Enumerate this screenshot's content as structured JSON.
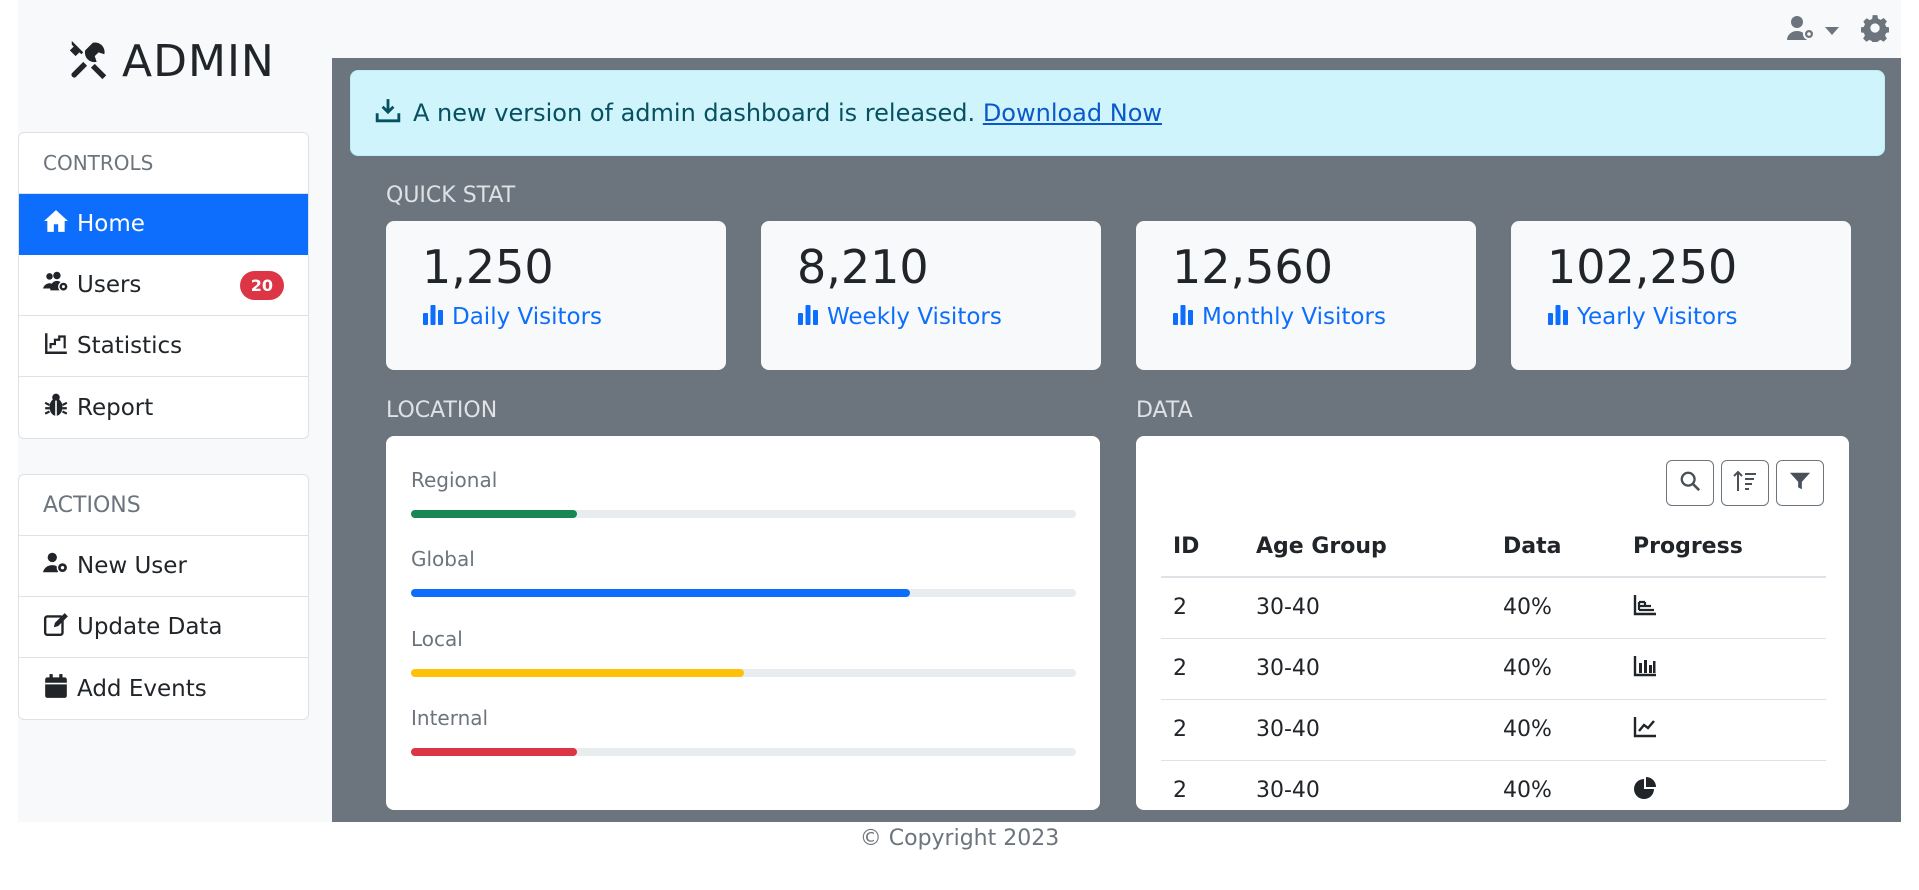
{
  "brand": {
    "name": "ADMIN"
  },
  "controls": {
    "heading": "CONTROLS",
    "items": [
      {
        "label": "Home"
      },
      {
        "label": "Users",
        "badge": "20"
      },
      {
        "label": "Statistics"
      },
      {
        "label": "Report"
      }
    ]
  },
  "actions": {
    "heading": "ACTIONS",
    "items": [
      {
        "label": "New User"
      },
      {
        "label": "Update Data"
      },
      {
        "label": "Add Events"
      }
    ]
  },
  "alert": {
    "text": "A new version of admin dashboard is released.",
    "link": "Download Now"
  },
  "quick_stat": {
    "title": "QUICK STAT",
    "cards": [
      {
        "value": "1,250",
        "label": "Daily Visitors"
      },
      {
        "value": "8,210",
        "label": "Weekly Visitors"
      },
      {
        "value": "12,560",
        "label": "Monthly Visitors"
      },
      {
        "value": "102,250",
        "label": "Yearly Visitors"
      }
    ]
  },
  "location": {
    "title": "LOCATION",
    "rows": [
      {
        "label": "Regional",
        "progress": 25,
        "color": "#198754"
      },
      {
        "label": "Global",
        "progress": 75,
        "color": "#0d6efd"
      },
      {
        "label": "Local",
        "progress": 50,
        "color": "#ffc107"
      },
      {
        "label": "Internal",
        "progress": 25,
        "color": "#dc3545"
      }
    ]
  },
  "data": {
    "title": "DATA",
    "tools": [
      "search-icon",
      "sort-icon",
      "filter-icon"
    ],
    "columns": [
      "ID",
      "Age Group",
      "Data",
      "Progress"
    ],
    "rows": [
      {
        "id": "2",
        "age": "30-40",
        "data": "40%",
        "icon": "chart-area-icon"
      },
      {
        "id": "2",
        "age": "30-40",
        "data": "40%",
        "icon": "chart-bar-icon"
      },
      {
        "id": "2",
        "age": "30-40",
        "data": "40%",
        "icon": "chart-line-icon"
      },
      {
        "id": "2",
        "age": "30-40",
        "data": "40%",
        "icon": "chart-pie-icon"
      }
    ]
  },
  "footer": {
    "text": "© Copyright 2023"
  }
}
